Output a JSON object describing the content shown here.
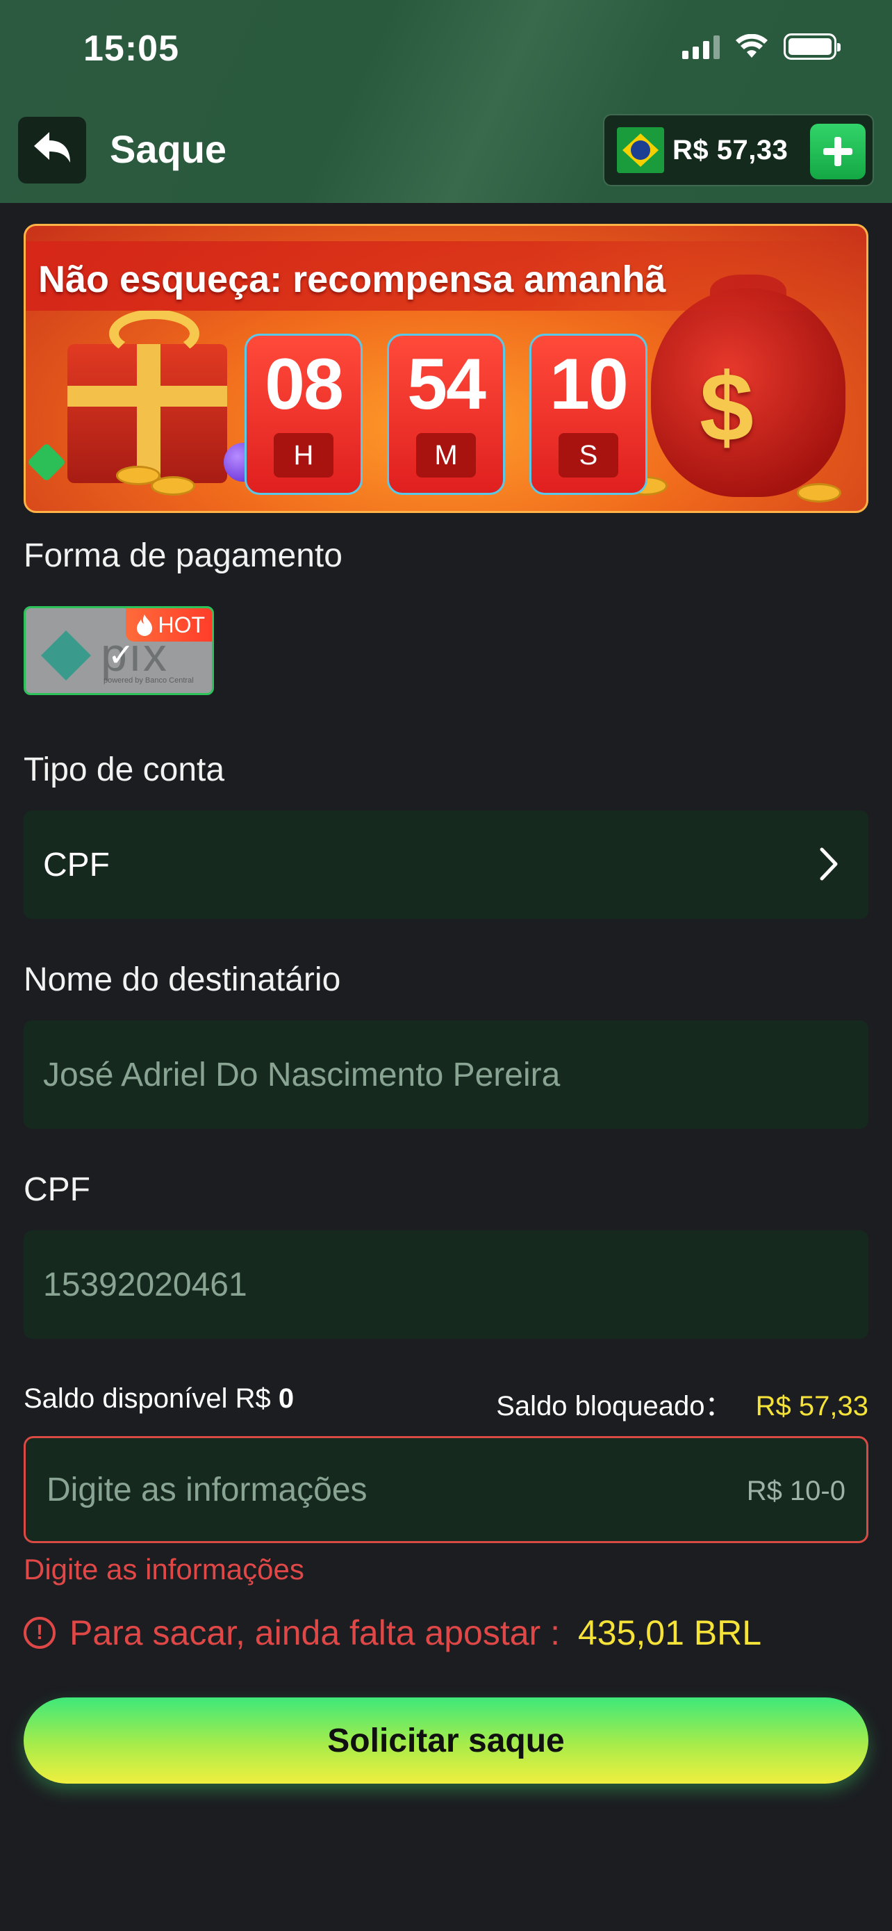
{
  "status_bar": {
    "time": "15:05"
  },
  "header": {
    "title": "Saque",
    "balance": "R$ 57,33"
  },
  "banner": {
    "title": "Não esqueça: recompensa amanhã",
    "countdown": [
      {
        "value": "08",
        "unit": "H"
      },
      {
        "value": "54",
        "unit": "M"
      },
      {
        "value": "10",
        "unit": "S"
      }
    ]
  },
  "payment": {
    "label": "Forma de pagamento",
    "method_logo": "pix",
    "method_logo_sub": "powered by Banco Central",
    "hot_badge": "HOT"
  },
  "account_type": {
    "label": "Tipo de conta",
    "value": "CPF"
  },
  "recipient": {
    "label": "Nome do destinatário",
    "value": "José Adriel Do Nascimento Pereira"
  },
  "cpf": {
    "label": "CPF",
    "value": "15392020461"
  },
  "balances": {
    "available_label": "Saldo disponível R$",
    "available_value": "0",
    "blocked_label": "Saldo bloqueado：",
    "blocked_value": "R$ 57,33"
  },
  "amount": {
    "placeholder": "Digite as informações",
    "range": "R$ 10-0",
    "error": "Digite as informações"
  },
  "warning": {
    "message": "Para sacar, ainda falta apostar :",
    "amount": "435,01 BRL"
  },
  "submit": {
    "label": "Solicitar saque"
  },
  "colors": {
    "accent_green": "#2ec25a",
    "error_red": "#e04848",
    "highlight_yellow": "#f6e33a",
    "field_bg": "#16291e",
    "page_bg": "#1c1d21"
  },
  "icons": [
    "back-arrow-icon",
    "brazil-flag-icon",
    "plus-icon",
    "chevron-right-icon",
    "fire-icon",
    "check-icon",
    "alert-circle-icon",
    "wifi-icon",
    "signal-icon",
    "battery-icon"
  ]
}
